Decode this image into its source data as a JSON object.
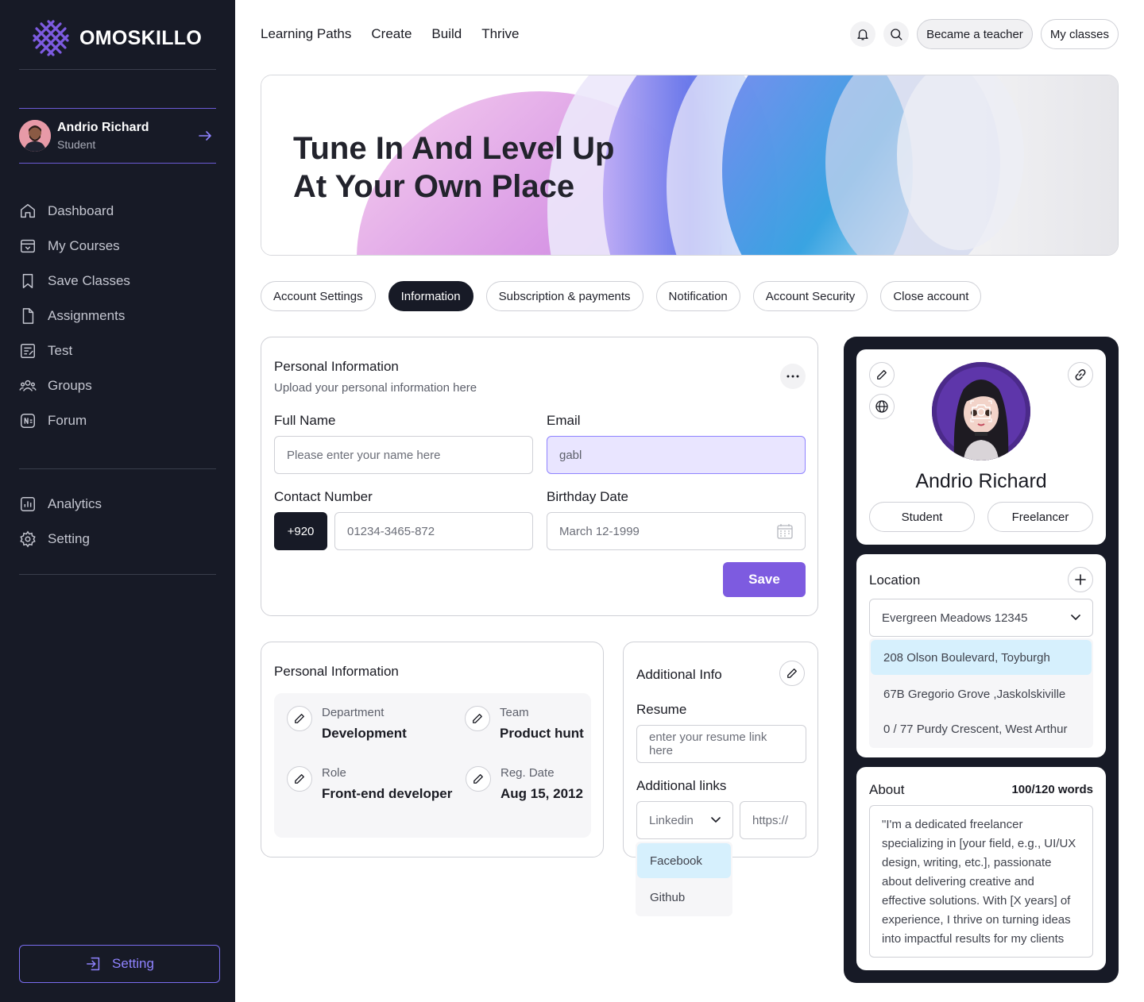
{
  "brand": {
    "name": "OMOSKILLO",
    "accent": "#7d5be0"
  },
  "user": {
    "name": "Andrio Richard",
    "role": "Student"
  },
  "sidebar": {
    "items": [
      {
        "label": "Dashboard",
        "icon": "home-icon"
      },
      {
        "label": "My Courses",
        "icon": "archive-icon"
      },
      {
        "label": "Save Classes",
        "icon": "bookmark-icon"
      },
      {
        "label": "Assignments",
        "icon": "file-icon"
      },
      {
        "label": "Test",
        "icon": "test-icon"
      },
      {
        "label": "Groups",
        "icon": "users-icon"
      },
      {
        "label": "Forum",
        "icon": "forum-icon"
      }
    ],
    "secondary": [
      {
        "label": "Analytics",
        "icon": "analytics-icon"
      },
      {
        "label": "Setting",
        "icon": "gear-icon"
      }
    ],
    "bottom_button": "Setting"
  },
  "topnav": {
    "links": [
      "Learning Paths",
      "Create",
      "Build",
      "Thrive"
    ],
    "became_teacher": "Became a teacher",
    "my_classes": "My classes"
  },
  "hero": {
    "line1": "Tune In And Level Up",
    "line2": "At Your Own Place"
  },
  "tabs": [
    {
      "label": "Account Settings"
    },
    {
      "label": "Information",
      "active": true
    },
    {
      "label": "Subscription & payments"
    },
    {
      "label": "Notification"
    },
    {
      "label": "Account Security"
    },
    {
      "label": "Close account"
    }
  ],
  "form": {
    "title": "Personal Information",
    "subtitle": "Upload your personal information here",
    "full_name_label": "Full Name",
    "full_name_placeholder": "Please enter your name here",
    "email_label": "Email",
    "email_value": "gabl",
    "contact_label": "Contact Number",
    "country_code": "+920",
    "phone_placeholder": "01234-3465-872",
    "birthday_label": "Birthday Date",
    "birthday_placeholder": "March 12-1999",
    "save_label": "Save"
  },
  "personal_info": {
    "title": "Personal Information",
    "department_label": "Department",
    "department_value": "Development",
    "team_label": "Team",
    "team_value": "Product hunt",
    "role_label": "Role",
    "role_value": "Front-end developer",
    "reg_label": "Reg. Date",
    "reg_value": "Aug 15, 2012"
  },
  "additional": {
    "title": "Additional Info",
    "resume_label": "Resume",
    "resume_placeholder": "enter your resume link here",
    "links_label": "Additional links",
    "link_type": "Linkedin",
    "link_placeholder": "https://",
    "link_options": [
      "Facebook",
      "Github"
    ]
  },
  "profile": {
    "name": "Andrio Richard",
    "roles": [
      "Student",
      "Freelancer"
    ]
  },
  "location": {
    "title": "Location",
    "selected": "Evergreen Meadows 12345",
    "options": [
      "208 Olson Boulevard, Toyburgh",
      "67B Gregorio Grove ,Jaskolskiville",
      "0 / 77 Purdy Crescent, West Arthur"
    ]
  },
  "about": {
    "title": "About",
    "count": "100/120 words",
    "text": "\"I'm a dedicated freelancer specializing in [your field, e.g., UI/UX design, writing, etc.], passionate about delivering creative and effective solutions. With [X years] of experience, I thrive on turning ideas into impactful results for my clients"
  }
}
